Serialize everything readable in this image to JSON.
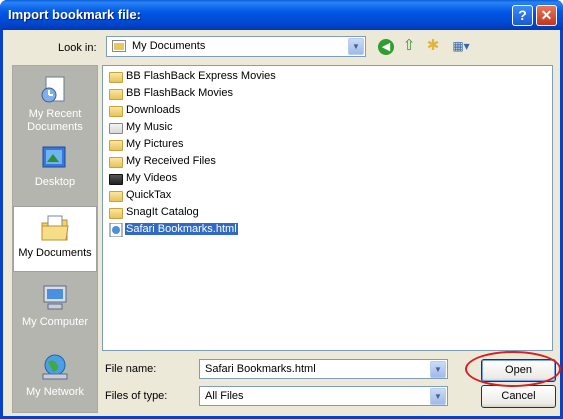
{
  "dialog": {
    "title": "Import bookmark file:",
    "help_button": "?",
    "close_button": "✕"
  },
  "toolbar": {
    "lookin_label": "Look in:",
    "lookin_value": "My Documents",
    "icons": [
      "back-icon",
      "up-folder-icon",
      "new-folder-icon",
      "view-menu-icon"
    ]
  },
  "places": [
    {
      "label": "My Recent Documents",
      "icon": "recent-documents-icon"
    },
    {
      "label": "Desktop",
      "icon": "desktop-icon"
    },
    {
      "label": "My Documents",
      "icon": "my-documents-icon",
      "selected": true
    },
    {
      "label": "My Computer",
      "icon": "my-computer-icon"
    },
    {
      "label": "My Network",
      "icon": "my-network-icon"
    }
  ],
  "files": [
    {
      "name": "BB FlashBack Express Movies",
      "type": "folder"
    },
    {
      "name": "BB FlashBack Movies",
      "type": "folder"
    },
    {
      "name": "Downloads",
      "type": "folder"
    },
    {
      "name": "My Music",
      "type": "music-folder"
    },
    {
      "name": "My Pictures",
      "type": "pictures-folder"
    },
    {
      "name": "My Received Files",
      "type": "folder"
    },
    {
      "name": "My Videos",
      "type": "videos-folder"
    },
    {
      "name": "QuickTax",
      "type": "folder"
    },
    {
      "name": "SnagIt Catalog",
      "type": "folder"
    },
    {
      "name": "Safari Bookmarks.html",
      "type": "html-file",
      "selected": true
    }
  ],
  "form": {
    "filename_label": "File name:",
    "filename_value": "Safari Bookmarks.html",
    "filetype_label": "Files of type:",
    "filetype_value": "All Files"
  },
  "buttons": {
    "open": "Open",
    "cancel": "Cancel"
  },
  "colors": {
    "titlebar": "#0058e6",
    "selection": "#316ac5",
    "highlight_ring": "#d72020"
  }
}
